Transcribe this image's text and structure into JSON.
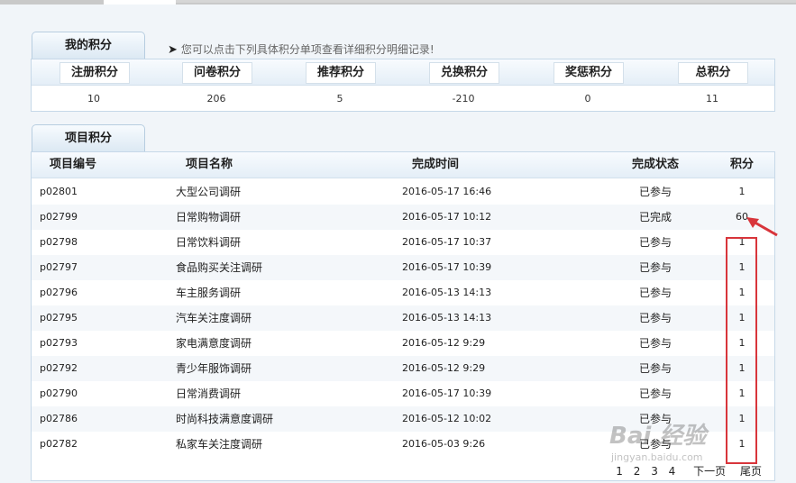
{
  "my_points_tab": "我的积分",
  "hint": "您可以点击下列具体积分单项查看详细积分明细记录!",
  "summary": [
    {
      "label": "注册积分",
      "value": "10"
    },
    {
      "label": "问卷积分",
      "value": "206"
    },
    {
      "label": "推荐积分",
      "value": "5"
    },
    {
      "label": "兑换积分",
      "value": "-210"
    },
    {
      "label": "奖惩积分",
      "value": "0"
    },
    {
      "label": "总积分",
      "value": "11"
    }
  ],
  "project_tab": "项目积分",
  "columns": {
    "id": "项目编号",
    "name": "项目名称",
    "time": "完成时间",
    "status": "完成状态",
    "score": "积分"
  },
  "rows": [
    {
      "id": "p02801",
      "name": "大型公司调研",
      "time": "2016-05-17 16:46",
      "status": "已参与",
      "score": "1"
    },
    {
      "id": "p02799",
      "name": "日常购物调研",
      "time": "2016-05-17 10:12",
      "status": "已完成",
      "score": "60"
    },
    {
      "id": "p02798",
      "name": "日常饮料调研",
      "time": "2016-05-17 10:37",
      "status": "已参与",
      "score": "1"
    },
    {
      "id": "p02797",
      "name": "食品购买关注调研",
      "time": "2016-05-17 10:39",
      "status": "已参与",
      "score": "1"
    },
    {
      "id": "p02796",
      "name": "车主服务调研",
      "time": "2016-05-13 14:13",
      "status": "已参与",
      "score": "1"
    },
    {
      "id": "p02795",
      "name": "汽车关注度调研",
      "time": "2016-05-13 14:13",
      "status": "已参与",
      "score": "1"
    },
    {
      "id": "p02793",
      "name": "家电满意度调研",
      "time": "2016-05-12 9:29",
      "status": "已参与",
      "score": "1"
    },
    {
      "id": "p02792",
      "name": "青少年服饰调研",
      "time": "2016-05-12 9:29",
      "status": "已参与",
      "score": "1"
    },
    {
      "id": "p02790",
      "name": "日常消费调研",
      "time": "2016-05-17 10:39",
      "status": "已参与",
      "score": "1"
    },
    {
      "id": "p02786",
      "name": "时尚科技满意度调研",
      "time": "2016-05-12 10:02",
      "status": "已参与",
      "score": "1"
    },
    {
      "id": "p02782",
      "name": "私家车关注度调研",
      "time": "2016-05-03 9:26",
      "status": "已参与",
      "score": "1"
    }
  ],
  "pager": {
    "pages": [
      "1",
      "2",
      "3",
      "4"
    ],
    "next": "下一页",
    "last": "尾页"
  },
  "watermark": {
    "brand": "Bai  经验",
    "url": "jingyan.baidu.com"
  },
  "colors": {
    "annotation": "#d8353b",
    "panel_border": "#c6d8e8",
    "header_bg": "#e4eef7"
  }
}
